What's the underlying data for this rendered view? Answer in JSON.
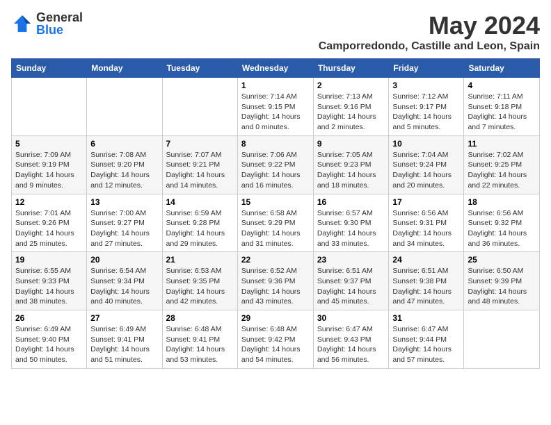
{
  "logo": {
    "general": "General",
    "blue": "Blue"
  },
  "title": "May 2024",
  "subtitle": "Camporredondo, Castille and Leon, Spain",
  "days_of_week": [
    "Sunday",
    "Monday",
    "Tuesday",
    "Wednesday",
    "Thursday",
    "Friday",
    "Saturday"
  ],
  "weeks": [
    [
      {
        "day": "",
        "info": ""
      },
      {
        "day": "",
        "info": ""
      },
      {
        "day": "",
        "info": ""
      },
      {
        "day": "1",
        "info": "Sunrise: 7:14 AM\nSunset: 9:15 PM\nDaylight: 14 hours and 0 minutes."
      },
      {
        "day": "2",
        "info": "Sunrise: 7:13 AM\nSunset: 9:16 PM\nDaylight: 14 hours and 2 minutes."
      },
      {
        "day": "3",
        "info": "Sunrise: 7:12 AM\nSunset: 9:17 PM\nDaylight: 14 hours and 5 minutes."
      },
      {
        "day": "4",
        "info": "Sunrise: 7:11 AM\nSunset: 9:18 PM\nDaylight: 14 hours and 7 minutes."
      }
    ],
    [
      {
        "day": "5",
        "info": "Sunrise: 7:09 AM\nSunset: 9:19 PM\nDaylight: 14 hours and 9 minutes."
      },
      {
        "day": "6",
        "info": "Sunrise: 7:08 AM\nSunset: 9:20 PM\nDaylight: 14 hours and 12 minutes."
      },
      {
        "day": "7",
        "info": "Sunrise: 7:07 AM\nSunset: 9:21 PM\nDaylight: 14 hours and 14 minutes."
      },
      {
        "day": "8",
        "info": "Sunrise: 7:06 AM\nSunset: 9:22 PM\nDaylight: 14 hours and 16 minutes."
      },
      {
        "day": "9",
        "info": "Sunrise: 7:05 AM\nSunset: 9:23 PM\nDaylight: 14 hours and 18 minutes."
      },
      {
        "day": "10",
        "info": "Sunrise: 7:04 AM\nSunset: 9:24 PM\nDaylight: 14 hours and 20 minutes."
      },
      {
        "day": "11",
        "info": "Sunrise: 7:02 AM\nSunset: 9:25 PM\nDaylight: 14 hours and 22 minutes."
      }
    ],
    [
      {
        "day": "12",
        "info": "Sunrise: 7:01 AM\nSunset: 9:26 PM\nDaylight: 14 hours and 25 minutes."
      },
      {
        "day": "13",
        "info": "Sunrise: 7:00 AM\nSunset: 9:27 PM\nDaylight: 14 hours and 27 minutes."
      },
      {
        "day": "14",
        "info": "Sunrise: 6:59 AM\nSunset: 9:28 PM\nDaylight: 14 hours and 29 minutes."
      },
      {
        "day": "15",
        "info": "Sunrise: 6:58 AM\nSunset: 9:29 PM\nDaylight: 14 hours and 31 minutes."
      },
      {
        "day": "16",
        "info": "Sunrise: 6:57 AM\nSunset: 9:30 PM\nDaylight: 14 hours and 33 minutes."
      },
      {
        "day": "17",
        "info": "Sunrise: 6:56 AM\nSunset: 9:31 PM\nDaylight: 14 hours and 34 minutes."
      },
      {
        "day": "18",
        "info": "Sunrise: 6:56 AM\nSunset: 9:32 PM\nDaylight: 14 hours and 36 minutes."
      }
    ],
    [
      {
        "day": "19",
        "info": "Sunrise: 6:55 AM\nSunset: 9:33 PM\nDaylight: 14 hours and 38 minutes."
      },
      {
        "day": "20",
        "info": "Sunrise: 6:54 AM\nSunset: 9:34 PM\nDaylight: 14 hours and 40 minutes."
      },
      {
        "day": "21",
        "info": "Sunrise: 6:53 AM\nSunset: 9:35 PM\nDaylight: 14 hours and 42 minutes."
      },
      {
        "day": "22",
        "info": "Sunrise: 6:52 AM\nSunset: 9:36 PM\nDaylight: 14 hours and 43 minutes."
      },
      {
        "day": "23",
        "info": "Sunrise: 6:51 AM\nSunset: 9:37 PM\nDaylight: 14 hours and 45 minutes."
      },
      {
        "day": "24",
        "info": "Sunrise: 6:51 AM\nSunset: 9:38 PM\nDaylight: 14 hours and 47 minutes."
      },
      {
        "day": "25",
        "info": "Sunrise: 6:50 AM\nSunset: 9:39 PM\nDaylight: 14 hours and 48 minutes."
      }
    ],
    [
      {
        "day": "26",
        "info": "Sunrise: 6:49 AM\nSunset: 9:40 PM\nDaylight: 14 hours and 50 minutes."
      },
      {
        "day": "27",
        "info": "Sunrise: 6:49 AM\nSunset: 9:41 PM\nDaylight: 14 hours and 51 minutes."
      },
      {
        "day": "28",
        "info": "Sunrise: 6:48 AM\nSunset: 9:41 PM\nDaylight: 14 hours and 53 minutes."
      },
      {
        "day": "29",
        "info": "Sunrise: 6:48 AM\nSunset: 9:42 PM\nDaylight: 14 hours and 54 minutes."
      },
      {
        "day": "30",
        "info": "Sunrise: 6:47 AM\nSunset: 9:43 PM\nDaylight: 14 hours and 56 minutes."
      },
      {
        "day": "31",
        "info": "Sunrise: 6:47 AM\nSunset: 9:44 PM\nDaylight: 14 hours and 57 minutes."
      },
      {
        "day": "",
        "info": ""
      }
    ]
  ]
}
